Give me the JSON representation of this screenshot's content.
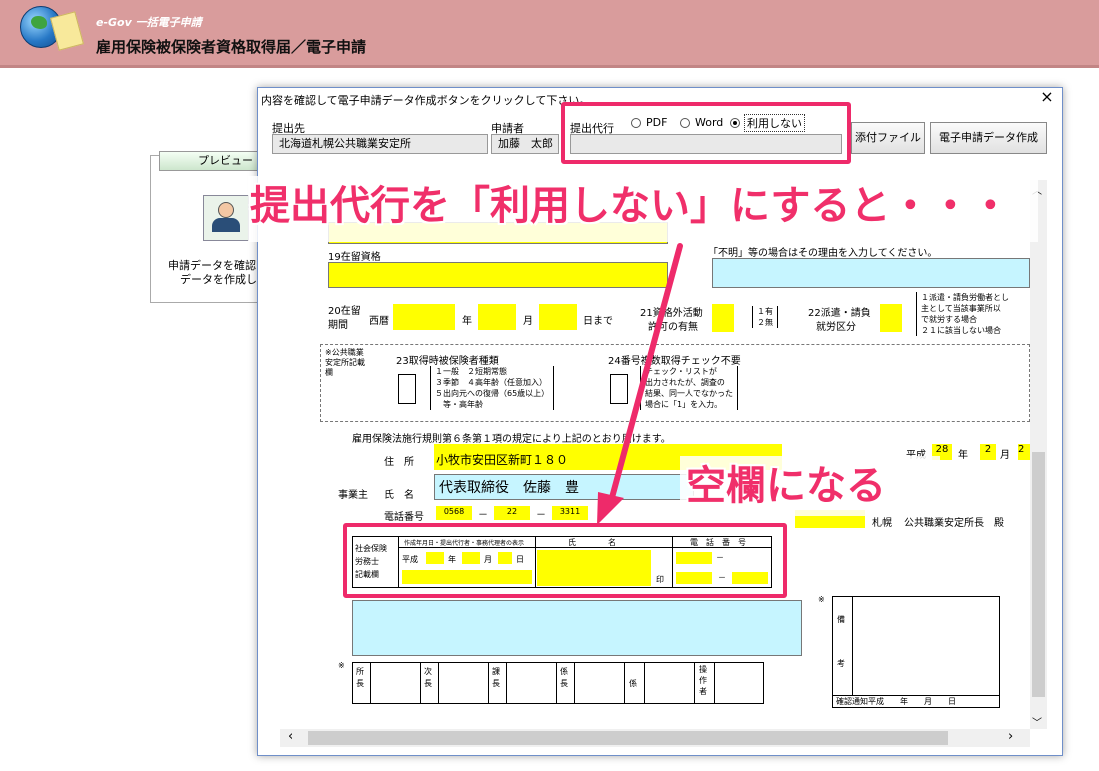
{
  "app": {
    "subtitle": "e-Gov 一括電子申請",
    "title": "雇用保険被保険者資格取得届／電子申請"
  },
  "preview": {
    "button_label": "プレビュー",
    "text_line1": "申請データを確認",
    "text_line2": "データを作成し"
  },
  "dialog": {
    "message": "内容を確認して電子申請データ作成ボタンをクリックして下さい。",
    "close": "×",
    "submit_to_label": "提出先",
    "submit_to_value": "北海道札幌公共職業安定所",
    "applicant_label": "申請者",
    "applicant_value": "加藤　太郎",
    "proxy_label": "提出代行",
    "proxy_options": [
      "PDF",
      "Word",
      "利用しない"
    ],
    "proxy_selected": "利用しない",
    "attach_button": "添付ファイル",
    "create_button": "電子申請データ作成"
  },
  "callouts": {
    "main": "提出代行を「利用しない」にすると・・・",
    "blank": "空欄になる"
  },
  "form": {
    "label19": "19在留資格",
    "unknown_note": "「不明」等の場合はその理由を入力してください。",
    "label20": "20在留\n期間",
    "seireki": "西暦",
    "nen": "年",
    "tsuki": "月",
    "hi": "日",
    "made": "日まで",
    "label21a": "21資格外活動",
    "label21b": "許可の有無",
    "opt21": "１有\n２無",
    "label22a": "22派遣・請負",
    "label22b": "就労区分",
    "opt22": "１派遣・請負労働者とし\n主として当該事業所以\nで就労する場合\n２１に該当しない場合",
    "public_office": "※公共職業安定所記載欄",
    "label23": "23取得時被保険者種類",
    "opt23": "１一般　２短期常態\n３季節　４高年齢（任意加入）\n５出向元への復帰（65歳以上）\n　等・高年齢",
    "label24": "24番号複数取得チェック不要",
    "opt24": "チェック・リストが\n出力されたが、調査の\n結果、同一人でなかった\n場合に「1」を入力。",
    "law_text": "雇用保険法施行規則第６条第１項の規定により上記のとおり届けます。",
    "heisei": "平成",
    "date_year": "28",
    "date_month": "2",
    "date_day": "2",
    "address_label": "住　所",
    "address_value": "小牧市安田区新町１８０",
    "employer_label": "事業主",
    "name_label": "氏　名",
    "name_value": "代表取締役　佐藤　豊",
    "phone_label": "電話番号",
    "phone1": "0568",
    "phone2": "22",
    "phone3": "3311",
    "dash": "－",
    "office_city": "札幌",
    "office_suffix": "公共職業安定所長　殿",
    "sr_label": "社会保険\n労務士\n記載欄",
    "sr_head1": "作成年月日・提出代行者・事務代理者の表示",
    "sr_head2": "氏　　　　名",
    "sr_head3": "電　話　番　号",
    "sr_heisei": "平成",
    "sr_nen": "年",
    "sr_tsuki": "月",
    "sr_hi": "日",
    "sr_in": "印",
    "star": "※",
    "stamp_cells": [
      "所\n長",
      "次\n長",
      "課\n長",
      "係\n長",
      "係",
      "操\n作\n者"
    ],
    "biko": "備\n\n\n\n考",
    "confirm_note": "確認通知平成　　年　　月　　日"
  }
}
